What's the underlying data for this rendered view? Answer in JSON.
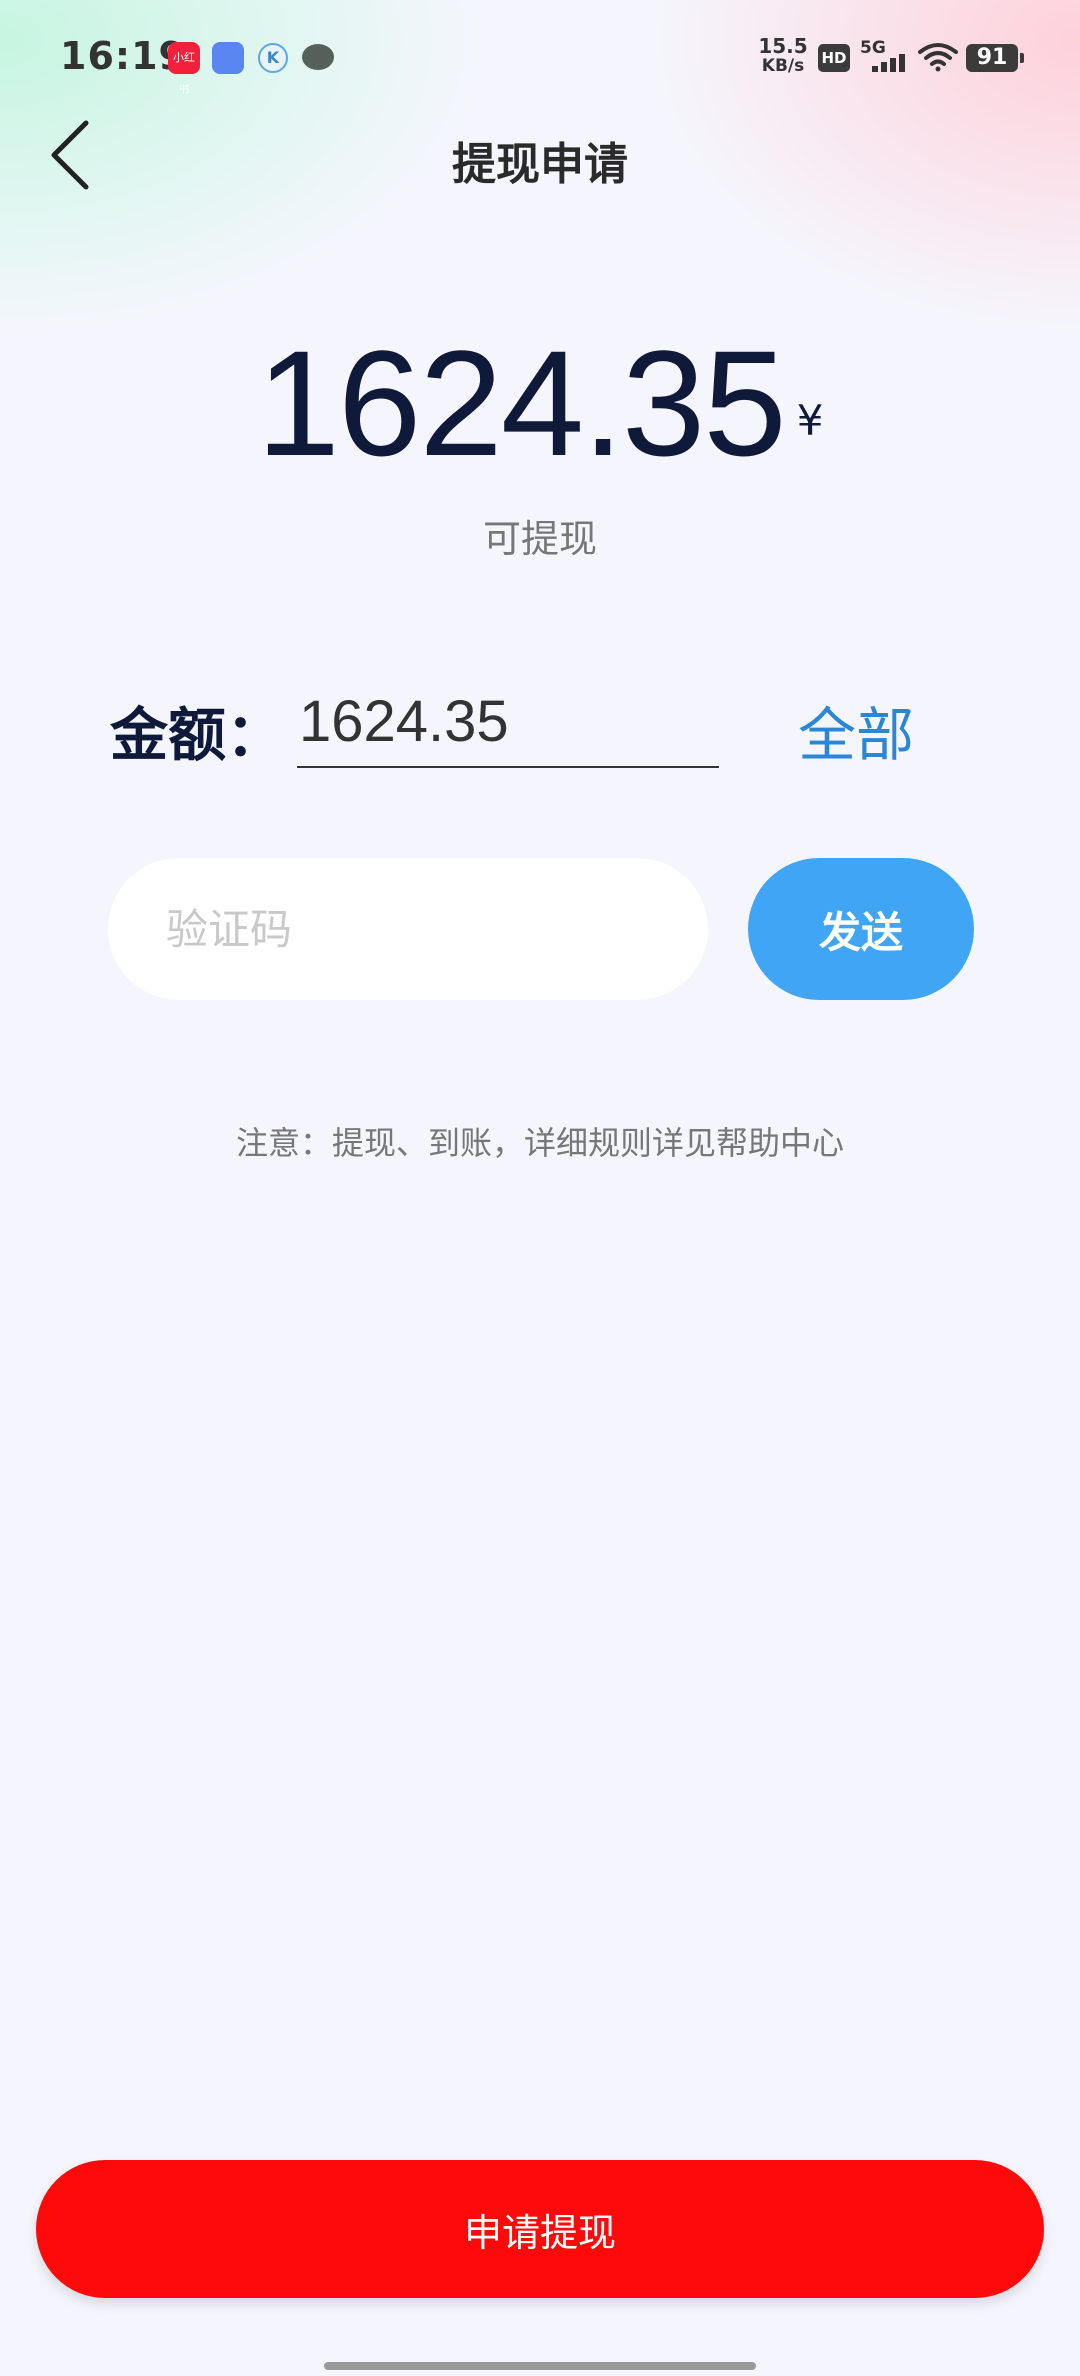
{
  "status_bar": {
    "time": "16:19",
    "net_speed_value": "15.5",
    "net_speed_unit": "KB/s",
    "hd": "HD",
    "network": "5G",
    "battery": "91",
    "notif_red_label": "小红书"
  },
  "header": {
    "title": "提现申请"
  },
  "balance": {
    "amount": "1624.35",
    "currency": "¥",
    "label": "可提现"
  },
  "form": {
    "amount_label": "金额：",
    "amount_value": "1624.35",
    "all_label": "全部",
    "code_placeholder": "验证码",
    "send_label": "发送"
  },
  "notice": "注意：提现、到账，详细规则详见帮助中心",
  "submit_label": "申请提现",
  "colors": {
    "submit": "#ff0a0a",
    "send": "#41a5f6",
    "link": "#2a86d6",
    "amount_text": "#0f1a3a"
  }
}
